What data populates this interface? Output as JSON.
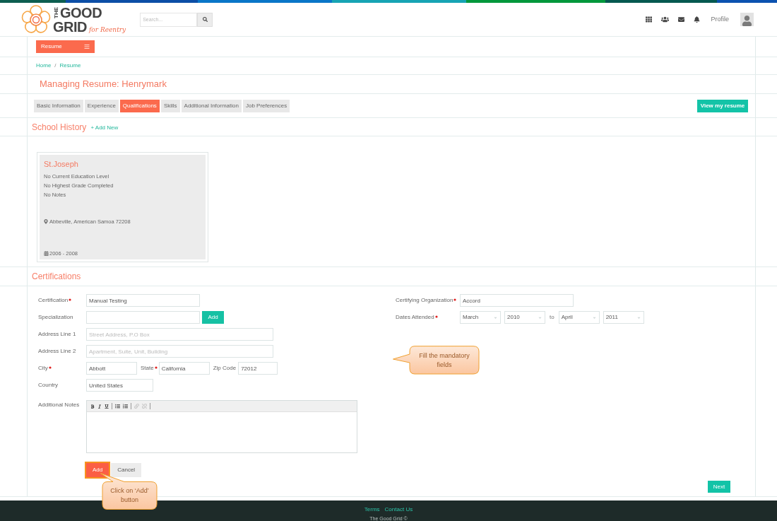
{
  "header": {
    "logo": {
      "vertical": "THE",
      "line1": "GOOD",
      "line2": "GRID",
      "tagline": "for Reentry"
    },
    "search": {
      "placeholder": "Search..."
    },
    "profile": "Profile"
  },
  "menu_button": "Resume",
  "breadcrumb": {
    "items": [
      "Home",
      "Resume"
    ],
    "separator": "/"
  },
  "page_title": "Managing Resume: Henrymark",
  "tabs": [
    {
      "label": "Basic Information",
      "selected": false
    },
    {
      "label": "Experience",
      "selected": false
    },
    {
      "label": "Qualifications",
      "selected": true
    },
    {
      "label": "Skills",
      "selected": false
    },
    {
      "label": "Additional Information",
      "selected": false
    },
    {
      "label": "Job Preferences",
      "selected": false
    }
  ],
  "view_button": "View my resume",
  "school_history": {
    "title": "School History",
    "add_link": "+ Add New",
    "cards": [
      {
        "name": "St.Joseph",
        "lines": [
          "No Current Education Level",
          "No Highest Grade Completed",
          "No Notes"
        ],
        "location": "Abbeville, American Samoa 72208",
        "dates": "2006 - 2008"
      }
    ]
  },
  "certifications": {
    "title": "Certifications",
    "left": [
      {
        "kind": "input",
        "label": "Certification",
        "required": true,
        "value": "Manual Testing"
      },
      {
        "kind": "input_add",
        "label": "Specialization",
        "required": false,
        "button": "Add"
      },
      {
        "kind": "input",
        "label": "Address Line 1",
        "required": false,
        "placeholder": "Street Address, P.O Box"
      },
      {
        "kind": "input",
        "label": "Address Line 2",
        "required": false,
        "placeholder": "Apartment, Suite, Unit, Building"
      },
      {
        "kind": "inline",
        "fields": [
          {
            "label": "City",
            "required": true,
            "value": "Abbott"
          },
          {
            "label": "State",
            "required": true,
            "value": "California"
          },
          {
            "label": "Zip Code",
            "required": false,
            "value": "72012"
          }
        ]
      },
      {
        "kind": "input",
        "label": "Country",
        "required": false,
        "value": "United States"
      },
      {
        "kind": "editor",
        "label": "Additional Notes",
        "required": false
      }
    ],
    "right": [
      {
        "kind": "input",
        "label": "Certifying Organization",
        "required": true,
        "value": "Accord"
      },
      {
        "kind": "date_range",
        "label": "Dates Attended",
        "required": true,
        "start": [
          "March",
          "2010"
        ],
        "separator": "to",
        "end": [
          "April",
          "2011"
        ]
      }
    ],
    "buttons": [
      {
        "label": "Add",
        "kind": "primary",
        "highlighted": true
      },
      {
        "label": "Cancel",
        "kind": "secondary",
        "highlighted": false
      }
    ]
  },
  "next_button": "Next",
  "callouts": [
    {
      "kind": "pointer_left",
      "text": "Fill the mandatory fields"
    },
    {
      "kind": "pointer_up",
      "text": "Click on ‘Add’ button"
    }
  ],
  "footer": {
    "links": [
      "Terms",
      "Contact Us"
    ],
    "copyright": "The Good Grid ©"
  }
}
